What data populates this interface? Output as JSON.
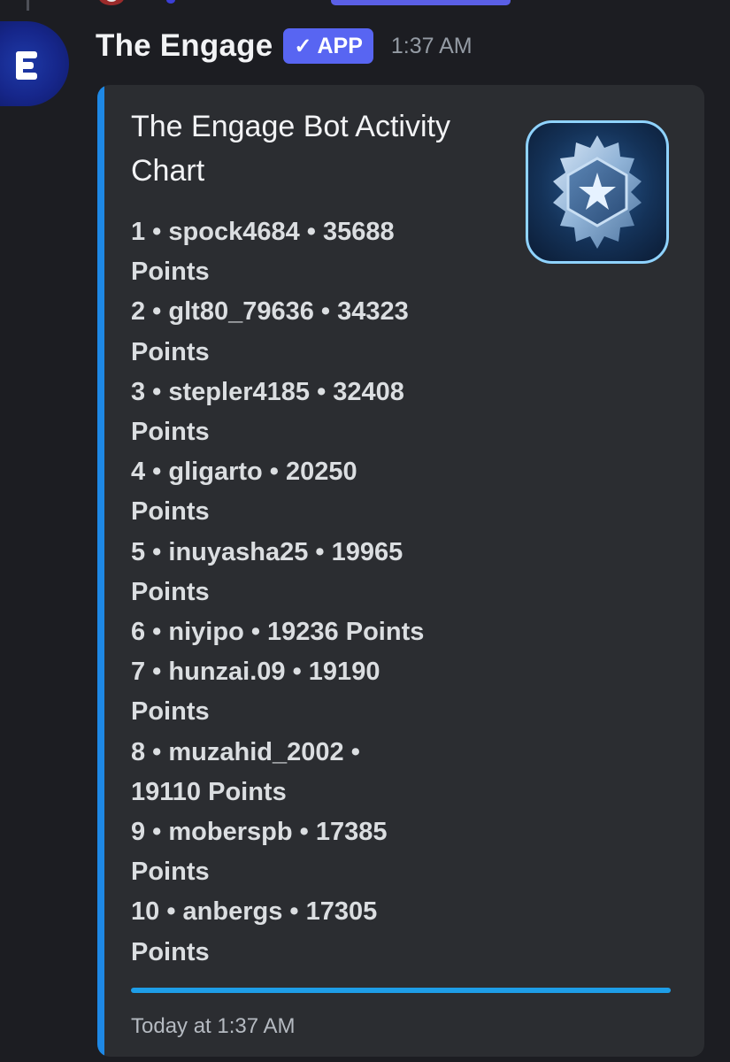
{
  "message": {
    "author": "The Engage",
    "badge": "APP",
    "badge_check": "✓",
    "timestamp": "1:37 AM",
    "avatar_icon": "engage-logo-icon"
  },
  "embed": {
    "title": "The Engage Bot Activity Chart",
    "thumbnail_icon": "medal-badge-icon",
    "border_color": "#1e88e5",
    "entries": [
      [
        "1 • spock4684 • 35688",
        "Points"
      ],
      [
        "2 • glt80_79636 • 34323",
        "Points"
      ],
      [
        "3 • stepler4185 • 32408",
        "Points"
      ],
      [
        "4 • gligarto • 20250",
        "Points"
      ],
      [
        "5 • inuyasha25 • 19965",
        "Points"
      ],
      [
        "6 • niyipo • 19236 Points"
      ],
      [
        "7 • hunzai.09 • 19190",
        "Points"
      ],
      [
        "8 • muzahid_2002 •",
        "19110 Points"
      ],
      [
        "9 • moberspb • 17385",
        "Points"
      ],
      [
        "10 • anbergs • 17305",
        "Points"
      ]
    ],
    "footer": "Today at 1:37 AM"
  },
  "colors": {
    "background": "#1c1d22",
    "embed_background": "#2b2d31",
    "badge": "#5865f2",
    "accent": "#1e88e5"
  }
}
